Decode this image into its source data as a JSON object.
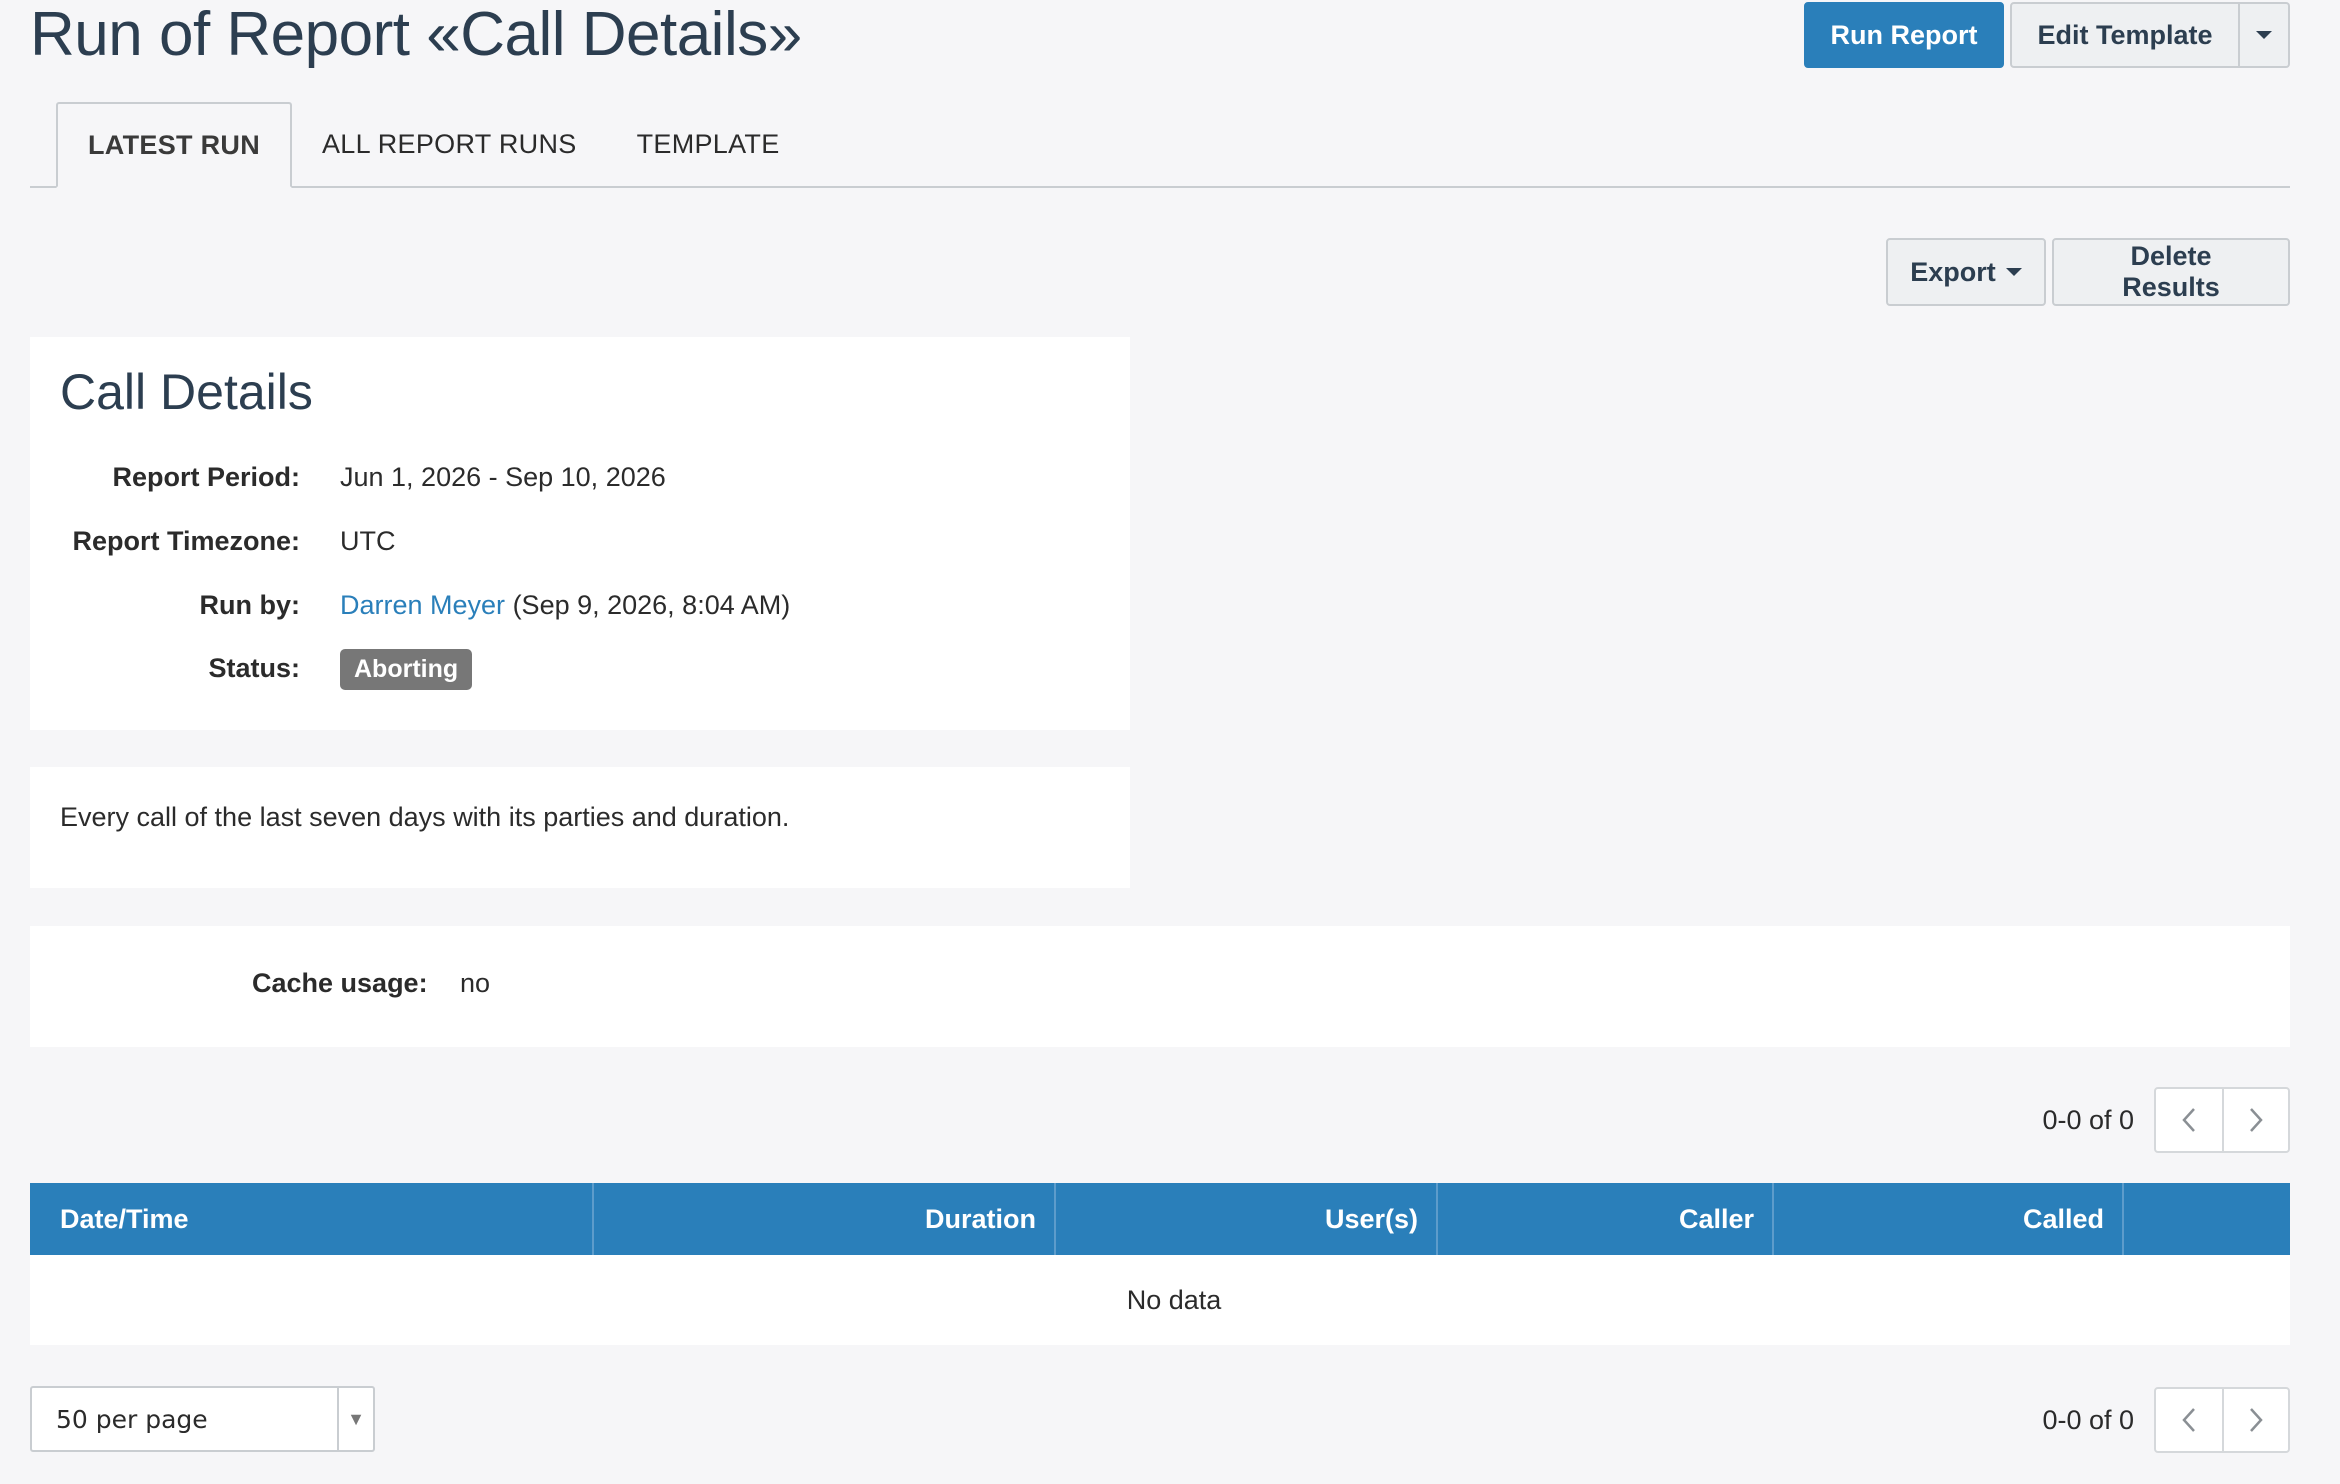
{
  "header": {
    "title": "Run of Report «Call Details»",
    "run_report_label": "Run Report",
    "edit_template_label": "Edit Template"
  },
  "tabs": [
    {
      "label": "LATEST RUN",
      "active": true
    },
    {
      "label": "ALL REPORT RUNS",
      "active": false
    },
    {
      "label": "TEMPLATE",
      "active": false
    }
  ],
  "actions": {
    "export_label": "Export",
    "delete_label": "Delete Results"
  },
  "details": {
    "heading": "Call Details",
    "period_label": "Report Period:",
    "period_value": "Jun 1, 2026 - Sep 10, 2026",
    "timezone_label": "Report Timezone:",
    "timezone_value": "UTC",
    "run_by_label": "Run by:",
    "run_by_user": "Darren Meyer",
    "run_by_time": "(Sep 9, 2026, 8:04 AM)",
    "status_label": "Status:",
    "status_value": "Aborting"
  },
  "description": "Every call of the last seven days with its parties and duration.",
  "cache": {
    "label": "Cache usage:",
    "value": "no"
  },
  "pagination": {
    "count": "0-0 of 0"
  },
  "table": {
    "columns": [
      "Date/Time",
      "Duration",
      "User(s)",
      "Caller",
      "Called"
    ],
    "empty_text": "No data"
  },
  "per_page": "50 per page",
  "colors": {
    "primary": "#2a7fba",
    "heading": "#2c3e50",
    "badge": "#777777",
    "background": "#f6f6f8"
  }
}
